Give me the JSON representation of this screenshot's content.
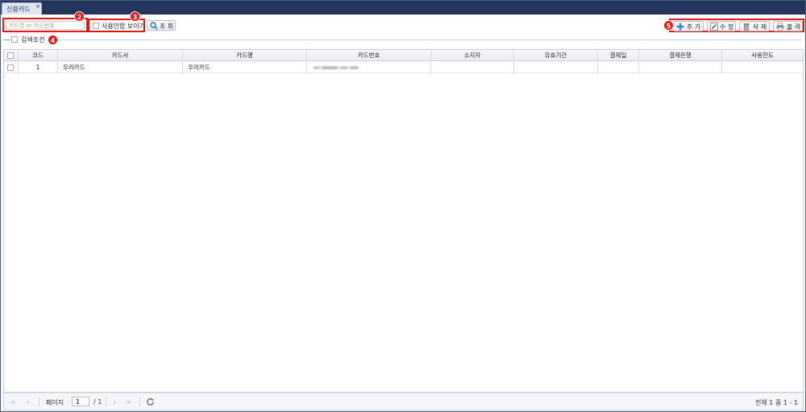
{
  "tab": {
    "title": "신용카드",
    "close_glyph": "×"
  },
  "toolbar": {
    "search_placeholder": "카드명 or 카드번호",
    "show_unused_label": "사용안함 보이기",
    "search_button": "조 회",
    "add_button": "추 가",
    "edit_button": "수 정",
    "delete_button": "삭 제",
    "print_button": "출 력"
  },
  "markers": [
    "2",
    "3",
    "4",
    "5"
  ],
  "search_condition": {
    "label": "검색조건"
  },
  "grid": {
    "columns": [
      "코드",
      "카드사",
      "카드명",
      "카드번호",
      "소지자",
      "유효기간",
      "결제일",
      "결제은행",
      "사용한도"
    ],
    "rows": [
      {
        "code": "1",
        "company": "우리카드",
        "name": "우리카드",
        "number": "",
        "holder": "",
        "expiry": "",
        "pay_day": "",
        "bank": "",
        "limit": ""
      }
    ]
  },
  "pager": {
    "page_label": "페이지",
    "page_value": "1",
    "total_pages": "/ 1",
    "summary": "전체 1 중 1 - 1"
  },
  "colors": {
    "accent": "#e01818",
    "tabbar": "#24365e",
    "header_bg": "#e9ecf3"
  }
}
